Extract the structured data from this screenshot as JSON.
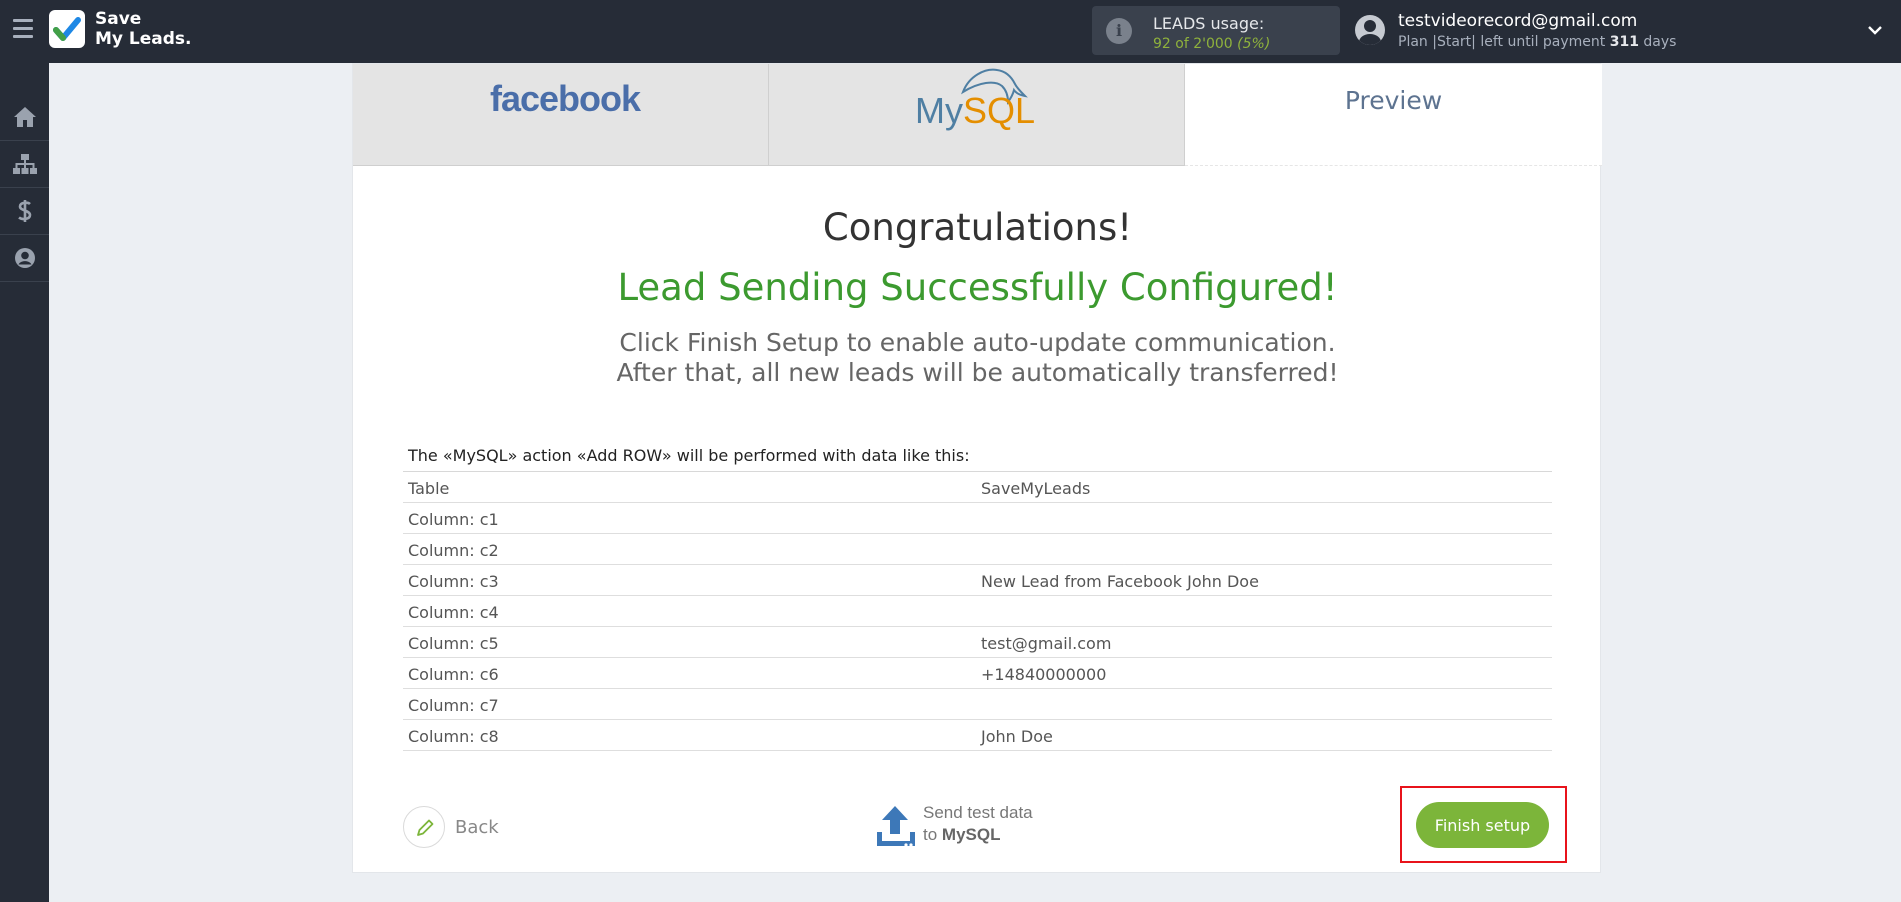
{
  "header": {
    "logo_line1": "Save",
    "logo_line2": "My Leads.",
    "leads_label": "LEADS usage:",
    "leads_used": "92 of 2'000",
    "leads_percent": "(5%)",
    "user_email": "testvideorecord@gmail.com",
    "plan_prefix": "Plan |Start| left until payment",
    "plan_days": "311",
    "plan_suffix": "days"
  },
  "sidebar": {
    "items": [
      {
        "icon": "home-icon"
      },
      {
        "icon": "sitemap-icon"
      },
      {
        "icon": "dollar-icon"
      },
      {
        "icon": "user-circle-icon"
      }
    ]
  },
  "tabs": {
    "source": "facebook",
    "destination_a": "My",
    "destination_b": "SQL",
    "preview": "Preview"
  },
  "main": {
    "congrats": "Congratulations!",
    "success": "Lead Sending Successfully Configured!",
    "instruction_1": "Click Finish Setup to enable auto-update communication.",
    "instruction_2": "After that, all new leads will be automatically transferred!",
    "table_caption": "The «MySQL» action «Add ROW» will be performed with data like this:"
  },
  "table_rows": [
    {
      "field": "Table",
      "value": "SaveMyLeads"
    },
    {
      "field": "Column: c1",
      "value": ""
    },
    {
      "field": "Column: c2",
      "value": ""
    },
    {
      "field": "Column: c3",
      "value": "New Lead from Facebook John Doe"
    },
    {
      "field": "Column: c4",
      "value": ""
    },
    {
      "field": "Column: c5",
      "value": "test@gmail.com"
    },
    {
      "field": "Column: c6",
      "value": "+14840000000"
    },
    {
      "field": "Column: c7",
      "value": ""
    },
    {
      "field": "Column: c8",
      "value": "John Doe"
    }
  ],
  "actions": {
    "back": "Back",
    "send_line1": "Send test data",
    "send_line2_prefix": "to",
    "send_line2_bold": "MySQL",
    "finish": "Finish setup"
  },
  "colors": {
    "topbar": "#262c37",
    "accent_green": "#7cb53a",
    "success_text": "#3c9a2f",
    "highlight_red": "#e8131b"
  }
}
